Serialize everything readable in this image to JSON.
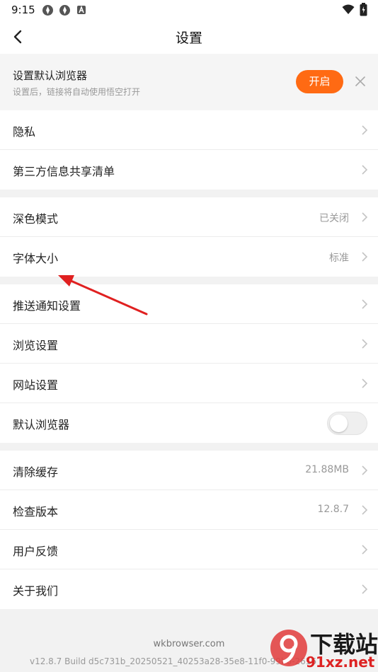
{
  "status_bar": {
    "time": "9:15"
  },
  "header": {
    "title": "设置"
  },
  "banner": {
    "title": "设置默认浏览器",
    "subtitle": "设置后，链接将自动使用悟空打开",
    "button_label": "开启"
  },
  "groups": [
    {
      "items": [
        {
          "label": "隐私"
        },
        {
          "label": "第三方信息共享清单"
        }
      ]
    },
    {
      "items": [
        {
          "label": "深色模式",
          "value": "已关闭"
        },
        {
          "label": "字体大小",
          "value": "标准"
        }
      ]
    },
    {
      "items": [
        {
          "label": "推送通知设置"
        },
        {
          "label": "浏览设置"
        },
        {
          "label": "网站设置"
        },
        {
          "label": "默认浏览器",
          "toggle": false
        }
      ]
    },
    {
      "items": [
        {
          "label": "清除缓存",
          "value": "21.88MB"
        },
        {
          "label": "检查版本",
          "value": "12.8.7"
        },
        {
          "label": "用户反馈"
        },
        {
          "label": "关于我们"
        }
      ]
    }
  ],
  "footer": {
    "site": "wkbrowser.com",
    "build": "v12.8.7 Build d5c731b_20250521_40253a28-35e8-11f0-99b6-2616"
  },
  "watermark": {
    "top": "下载站",
    "bottom": "91xz.net",
    "logo": "9"
  },
  "colors": {
    "accent": "#ff6a13",
    "annotation_arrow": "#e02020"
  }
}
